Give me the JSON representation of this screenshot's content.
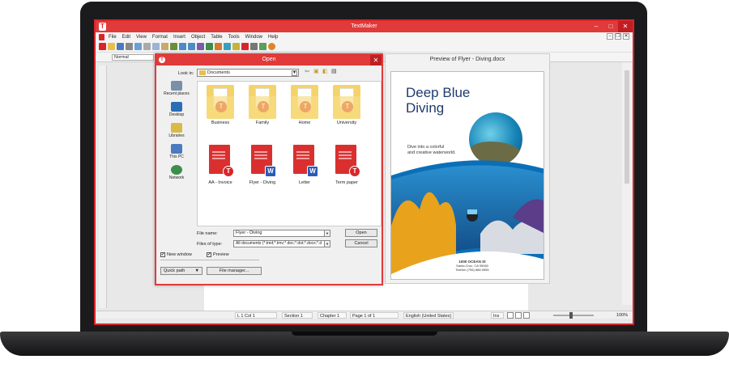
{
  "app": {
    "title": "TextMaker",
    "menu": [
      "File",
      "Edit",
      "View",
      "Format",
      "Insert",
      "Object",
      "Table",
      "Tools",
      "Window",
      "Help"
    ],
    "style_box": "Normal"
  },
  "dialog": {
    "title": "Open",
    "look_in_label": "Look in:",
    "look_in_value": "Documents",
    "places": [
      {
        "label": "Recent places",
        "icon": "recent-places-icon",
        "color": "#7a8fa8"
      },
      {
        "label": "Desktop",
        "icon": "desktop-icon",
        "color": "#2a6fb5"
      },
      {
        "label": "Libraries",
        "icon": "libraries-icon",
        "color": "#d9b94a"
      },
      {
        "label": "This PC",
        "icon": "computer-icon",
        "color": "#4b7bbf"
      },
      {
        "label": "Network",
        "icon": "network-icon",
        "color": "#3c8e4c"
      }
    ],
    "folders": [
      "Business",
      "Family",
      "Home",
      "University"
    ],
    "files": [
      {
        "label": "AA - Invoice",
        "badge": "T"
      },
      {
        "label": "Flyer - Diving",
        "badge": "W"
      },
      {
        "label": "Letter",
        "badge": "W"
      },
      {
        "label": "Term paper",
        "badge": "T"
      }
    ],
    "file_name_label": "File name:",
    "file_name_value": "Flyer - Diving",
    "file_type_label": "Files of type:",
    "file_type_value": "All documents (*.tmd;*.tmv;*.doc;*.dot;*.docx;*.d",
    "open_button": "Open",
    "cancel_button": "Cancel",
    "new_window_label": "New window",
    "new_window_checked": true,
    "preview_label": "Preview",
    "preview_checked": true,
    "quick_path_button": "Quick path",
    "file_manager_button": "File manager..."
  },
  "preview": {
    "title": "Preview of Flyer - Diving.docx",
    "flyer_heading_line1": "Deep Blue",
    "flyer_heading_line2": "Diving",
    "flyer_tagline_line1": "Dive into a colorful",
    "flyer_tagline_line2": "and creative waterworld.",
    "flyer_address_line1": "1000 OCEAN St",
    "flyer_address_line2": "Santa Cruz, CA 95060",
    "flyer_address_line3": "Telefon (755) 888 5555"
  },
  "status": {
    "position": "L 1 Col 1",
    "section": "Section 1",
    "chapter": "Chapter 1",
    "page": "Page 1 of 1",
    "language": "English (United States)",
    "mode": "Ins",
    "zoom": "100%"
  }
}
